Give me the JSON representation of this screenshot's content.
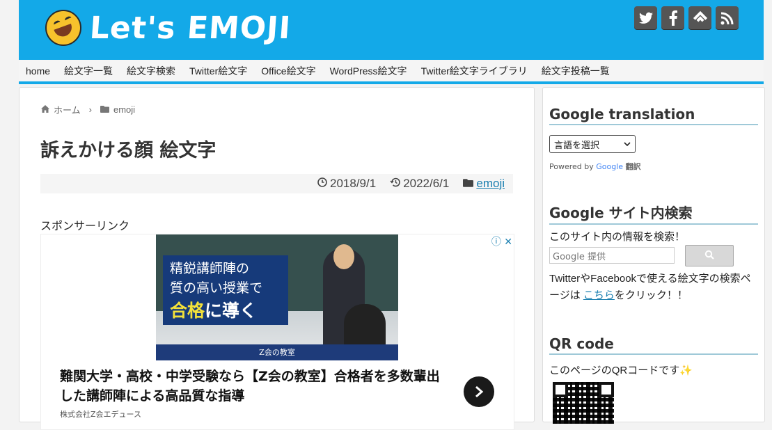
{
  "header": {
    "logo_text": "Let's EMOJI",
    "logo_emoji": "rolling-on-floor-laughing-emoji",
    "accent_color": "#13a9e8",
    "social_icons": [
      {
        "name": "twitter-icon",
        "glyph": "🐦"
      },
      {
        "name": "facebook-icon",
        "glyph": "f"
      },
      {
        "name": "feedly-icon",
        "glyph": "◈"
      },
      {
        "name": "rss-icon",
        "glyph": "≋"
      }
    ]
  },
  "nav": {
    "items": [
      "home",
      "絵文字一覧",
      "絵文字検索",
      "Twitter絵文字",
      "Office絵文字",
      "WordPress絵文字",
      "Twitter絵文字ライブラリ",
      "絵文字投稿一覧"
    ]
  },
  "main": {
    "breadcrumb": {
      "home": "ホーム",
      "separator": "›",
      "category": "emoji"
    },
    "title": "訴えかける顔 絵文字",
    "meta": {
      "published": "2018/9/1",
      "updated": "2022/6/1",
      "category": "emoji"
    },
    "sponsor_label": "スポンサーリンク",
    "ad": {
      "image_lines": [
        "精鋭講師陣の",
        "質の高い授業で",
        "合格",
        "に導く"
      ],
      "image_footer": "Z会の教室",
      "title": "難関大学・高校・中学受験なら【Z会の教室】合格者を多数輩出した講師陣による高品質な指導",
      "company": "株式会社Z会エデュース",
      "close_icon": "ⓘ ✕"
    }
  },
  "sidebar": {
    "translation": {
      "title": "Google translation",
      "select_value": "言語を選択",
      "powered_by": "Powered by",
      "google": "Google",
      "translate": "翻訳"
    },
    "site_search": {
      "title": "Google サイト内検索",
      "description": "このサイト内の情報を検索！",
      "placeholder": "Google 提供",
      "button_icon": "🔍",
      "note_prefix": "TwitterやFacebookで使える絵文字の検索ページは",
      "note_link": "こちら",
      "note_suffix": "をクリック！！"
    },
    "qr": {
      "title": "QR code",
      "description": "このページのQRコードです✨"
    }
  }
}
